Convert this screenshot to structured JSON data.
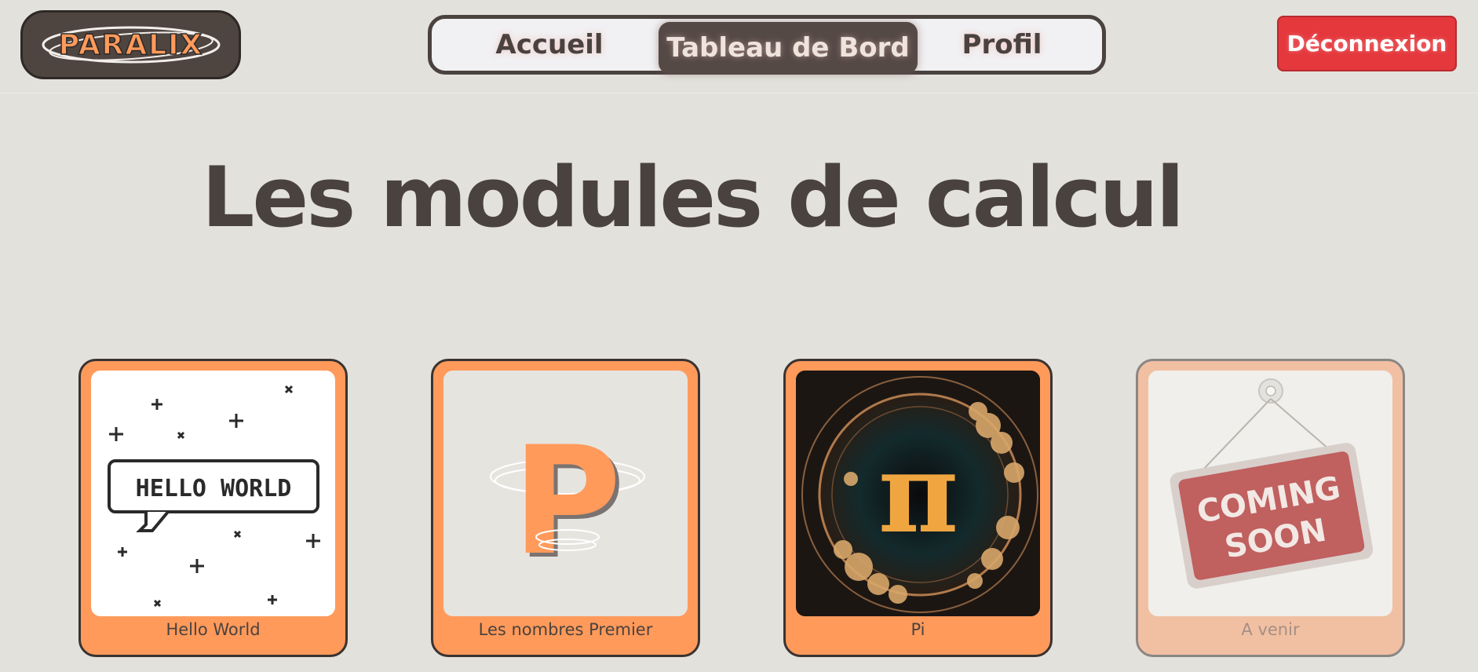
{
  "header": {
    "logo_text": "PARALIX",
    "nav": {
      "items": [
        {
          "label": "Accueil",
          "active": false
        },
        {
          "label": "Tableau de Bord",
          "active": true
        },
        {
          "label": "Profil",
          "active": false
        }
      ]
    },
    "logout_label": "Déconnexion"
  },
  "main": {
    "title": "Les modules de calcul",
    "cards": [
      {
        "label": "Hello World",
        "image_text": "HELLO WORLD",
        "image": "hello-world-pixel-art",
        "disabled": false
      },
      {
        "label": "Les nombres Premier",
        "image_text": "P",
        "image": "letter-p-logo",
        "disabled": false
      },
      {
        "label": "Pi",
        "image_text": "π",
        "image": "pi-cosmic-art",
        "disabled": false
      },
      {
        "label": "A venir",
        "image_text": "COMING SOON",
        "image": "coming-soon-sign",
        "disabled": true
      }
    ]
  },
  "colors": {
    "background": "#e3e1dc",
    "text": "#4a423f",
    "accent_orange": "#ff9a5b",
    "danger_red": "#e4383d"
  }
}
